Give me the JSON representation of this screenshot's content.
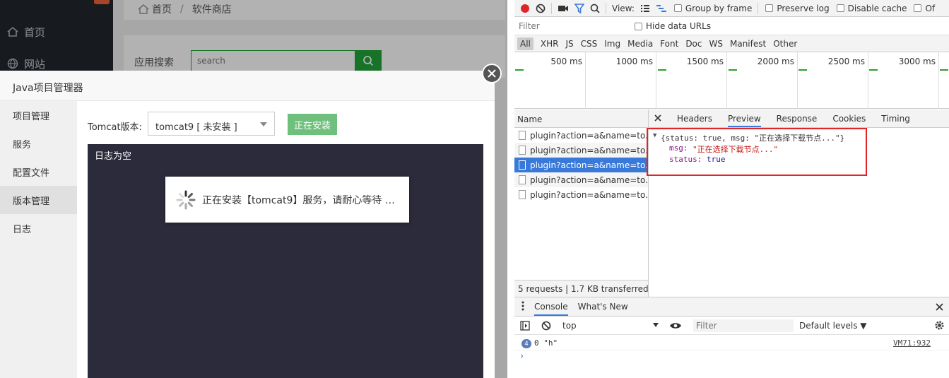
{
  "sidebar": {
    "items": [
      {
        "label": "首页",
        "icon": "home-icon"
      },
      {
        "label": "网站",
        "icon": "globe-icon"
      }
    ]
  },
  "breadcrumb": {
    "home": "首页",
    "separator": "/",
    "current": "软件商店"
  },
  "search": {
    "label": "应用搜索",
    "placeholder": "search"
  },
  "modal": {
    "title": "Java项目管理器",
    "tabs": [
      "项目管理",
      "服务",
      "配置文件",
      "版本管理",
      "日志"
    ],
    "tomcat_label": "Tomcat版本:",
    "tomcat_selected": "tomcat9 [ 未安装 ]",
    "install_button": "正在安装",
    "log_text": "日志为空",
    "loading_text": "正在安装【tomcat9】服务，请耐心等待 …"
  },
  "devtools": {
    "toolbar": {
      "view_label": "View:",
      "group_by_frame": "Group by frame",
      "preserve_log": "Preserve log",
      "disable_cache": "Disable cache",
      "offline_cut": "Of"
    },
    "filter_placeholder": "Filter",
    "hide_data_urls": "Hide data URLs",
    "types": [
      "All",
      "XHR",
      "JS",
      "CSS",
      "Img",
      "Media",
      "Font",
      "Doc",
      "WS",
      "Manifest",
      "Other"
    ],
    "overview_labels": [
      "500 ms",
      "1000 ms",
      "1500 ms",
      "2000 ms",
      "2500 ms",
      "3000 ms"
    ],
    "name_header": "Name",
    "requests": [
      "plugin?action=a&name=to...",
      "plugin?action=a&name=to...",
      "plugin?action=a&name=to...",
      "plugin?action=a&name=to...",
      "plugin?action=a&name=to..."
    ],
    "selected_request": 2,
    "detail_tabs": [
      "Headers",
      "Preview",
      "Response",
      "Cookies",
      "Timing"
    ],
    "active_detail_tab": "Preview",
    "preview": {
      "summary": "{status: true, msg: \"正在选择下载节点...\"}",
      "msg_key": "msg:",
      "msg_value": "\"正在选择下载节点...\"",
      "status_key": "status:",
      "status_value": "true"
    },
    "status_bar": "5 requests  |  1.7 KB transferred  |...",
    "drawer_tabs": [
      "Console",
      "What's New"
    ],
    "console": {
      "context": "top",
      "filter_placeholder": "Filter",
      "levels": "Default levels ▼",
      "count": "4",
      "message": "0 \"h\"",
      "source": "VM71:932",
      "prompt": "›"
    }
  }
}
